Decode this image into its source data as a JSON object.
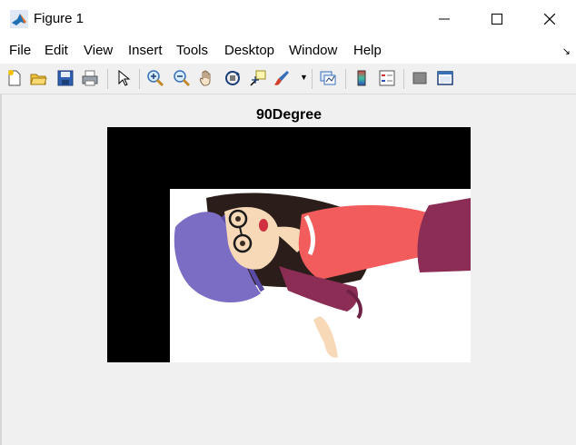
{
  "window": {
    "title": "Figure 1"
  },
  "menu": [
    "File",
    "Edit",
    "View",
    "Insert",
    "Tools",
    "Desktop",
    "Window",
    "Help"
  ],
  "toolbar": {
    "icons": [
      "new-figure-icon",
      "open-file-icon",
      "save-icon",
      "print-icon",
      "pointer-icon",
      "zoom-in-icon",
      "zoom-out-icon",
      "pan-icon",
      "rotate-3d-icon",
      "data-cursor-icon",
      "brush-icon",
      "link-plot-icon",
      "colorbar-icon",
      "legend-icon",
      "hide-plot-tools-icon",
      "show-plot-tools-icon"
    ]
  },
  "figure": {
    "title": "90Degree"
  },
  "colors": {
    "axes_bg": "#000000",
    "accent_red": "#f25c5c",
    "hat": "#7b6cc4",
    "pants": "#8b2d55",
    "skin": "#f7d9b8"
  }
}
